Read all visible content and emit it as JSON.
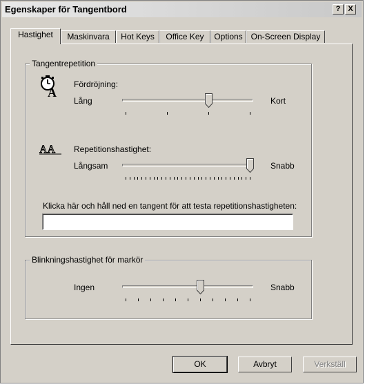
{
  "window": {
    "title": "Egenskaper för Tangentbord",
    "help_label": "?",
    "close_label": "X"
  },
  "tabs": [
    {
      "label": "Hastighet"
    },
    {
      "label": "Maskinvara"
    },
    {
      "label": "Hot Keys"
    },
    {
      "label": "Office Key"
    },
    {
      "label": "Options"
    },
    {
      "label": "On-Screen Display"
    }
  ],
  "active_tab": "Hastighet",
  "repeat_group": {
    "label": "Tangentrepetition",
    "delay": {
      "label": "Fördröjning:",
      "min_label": "Lång",
      "max_label": "Kort",
      "value_fraction": 0.67,
      "tick_count": 4
    },
    "rate": {
      "label": "Repetitionshastighet:",
      "min_label": "Långsam",
      "max_label": "Snabb",
      "value_fraction": 1.0,
      "tick_count": 32
    },
    "test_label": "Klicka här och håll ned en tangent för att testa repetitionshastigheten:",
    "test_value": ""
  },
  "cursor_group": {
    "label": "Blinkningshastighet för markör",
    "min_label": "Ingen",
    "max_label": "Snabb",
    "value_fraction": 0.6,
    "tick_count": 11
  },
  "buttons": {
    "ok": "OK",
    "cancel": "Avbryt",
    "apply": "Verkställ"
  }
}
